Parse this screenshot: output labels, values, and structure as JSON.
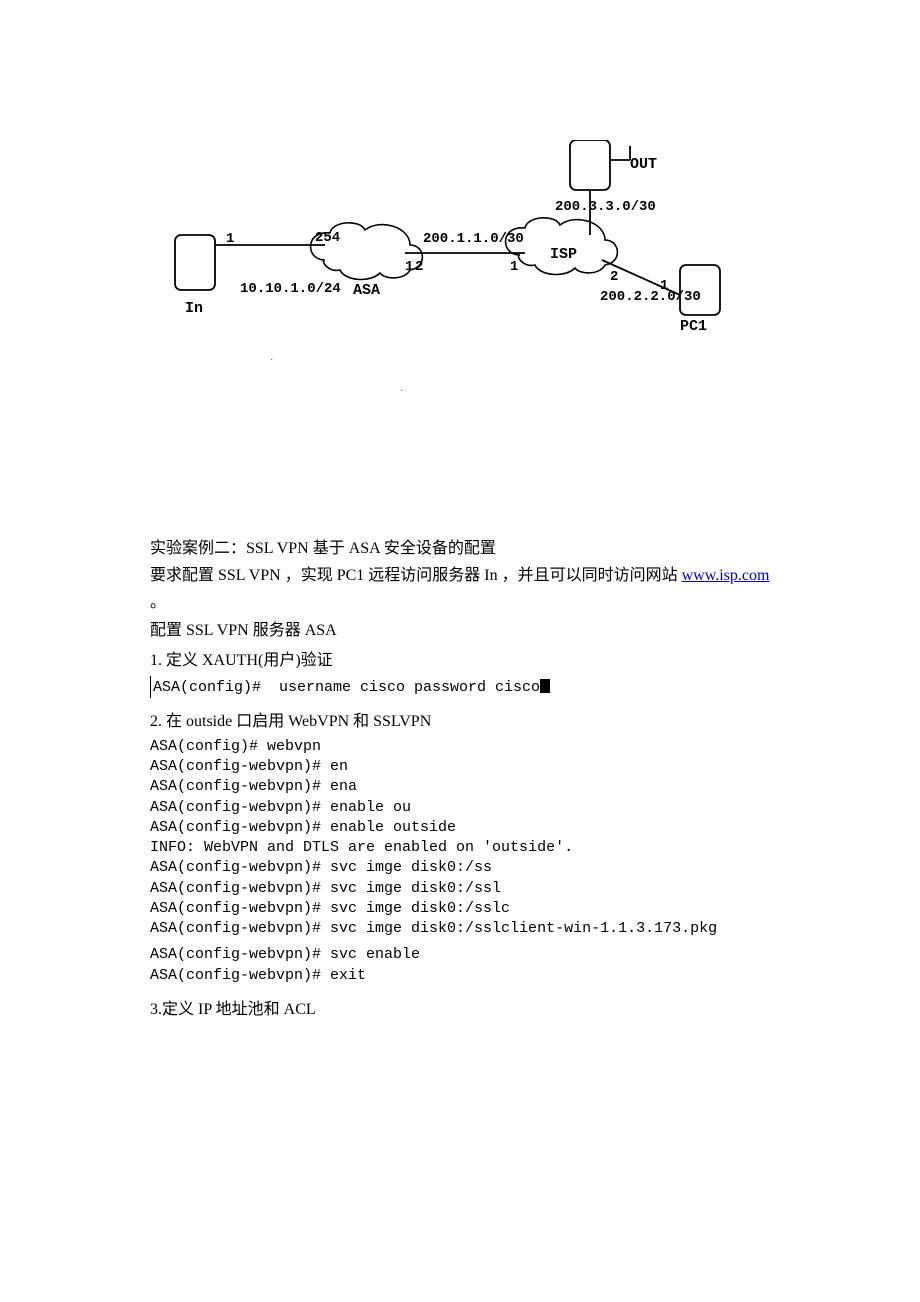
{
  "diagram": {
    "out_label": "OUT",
    "net_top": "200.3.3.0/30",
    "isp": "ISP",
    "net_mid": "200.1.1.0/30",
    "net_right": "200.2.2.0/30",
    "asa": "ASA",
    "net_left": "10.10.1.0/24",
    "in_label": "In",
    "pc1": "PC1",
    "n1": "1",
    "n2": "2",
    "n254": "254"
  },
  "title": "实验案例二：SSL VPN 基于 ASA 安全设备的配置",
  "req_prefix": "要求配置 SSL VPN ，实现 PC1 远程访问服务器 In ，并且可以同时访问网站 ",
  "link_text": "www.isp.com",
  "period": "。",
  "subtitle": "配置 SSL VPN 服务器 ASA",
  "step1": "1.   定义 XAUTH(用户)验证",
  "cli1": {
    "l1": "ASA(config)#  username cisco password cisco"
  },
  "step2": "2.   在 outside 口启用 WebVPN 和 SSLVPN",
  "cli2": {
    "l1": "ASA(config)# webvpn",
    "l2": "ASA(config-webvpn)# en",
    "l3": "ASA(config-webvpn)# ena",
    "l4": "ASA(config-webvpn)# enable ou",
    "l5": "ASA(config-webvpn)# enable outside",
    "l6": "INFO: WebVPN and DTLS are enabled on 'outside'.",
    "l7": "ASA(config-webvpn)# svc imge disk0:/ss",
    "l8": "ASA(config-webvpn)# svc imge disk0:/ssl",
    "l9": "ASA(config-webvpn)# svc imge disk0:/sslc",
    "l10": "ASA(config-webvpn)# svc imge disk0:/sslclient-win-1.1.3.173.pkg",
    "l11": "ASA(config-webvpn)# svc enable",
    "l12": "ASA(config-webvpn)# exit"
  },
  "step3": "3.定义 IP 地址池和 ACL",
  "sep": "·"
}
